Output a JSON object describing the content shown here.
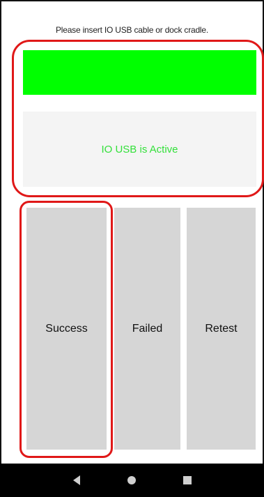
{
  "prompt": "Please insert IO USB cable or dock cradle.",
  "status": {
    "text": "IO USB is Active",
    "bar_color": "#00ff00",
    "text_color": "#33e03a"
  },
  "buttons": {
    "success": "Success",
    "failed": "Failed",
    "retest": "Retest"
  },
  "navbar": {
    "back": "back-icon",
    "home": "home-icon",
    "recents": "recents-icon"
  }
}
